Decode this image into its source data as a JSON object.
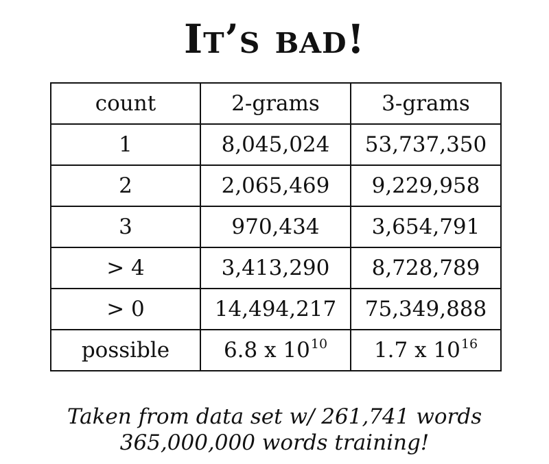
{
  "title": "It’s bad!",
  "table": {
    "headers": [
      "count",
      "2-grams",
      "3-grams"
    ],
    "rows": [
      {
        "count": "1",
        "bigrams": "8,045,024",
        "trigrams": "53,737,350"
      },
      {
        "count": "2",
        "bigrams": "2,065,469",
        "trigrams": "9,229,958"
      },
      {
        "count": "3",
        "bigrams": "970,434",
        "trigrams": "3,654,791"
      },
      {
        "count": "> 4",
        "bigrams": "3,413,290",
        "trigrams": "8,728,789"
      },
      {
        "count": "> 0",
        "bigrams": "14,494,217",
        "trigrams": "75,349,888"
      }
    ],
    "possible": {
      "label": "possible",
      "bigrams": {
        "base": "6.8 x 10",
        "exponent": "10"
      },
      "trigrams": {
        "base": "1.7 x 10",
        "exponent": "16"
      }
    }
  },
  "caption": {
    "line1": "Taken from data set w/ 261,741 words",
    "line2": "365,000,000 words training!"
  }
}
